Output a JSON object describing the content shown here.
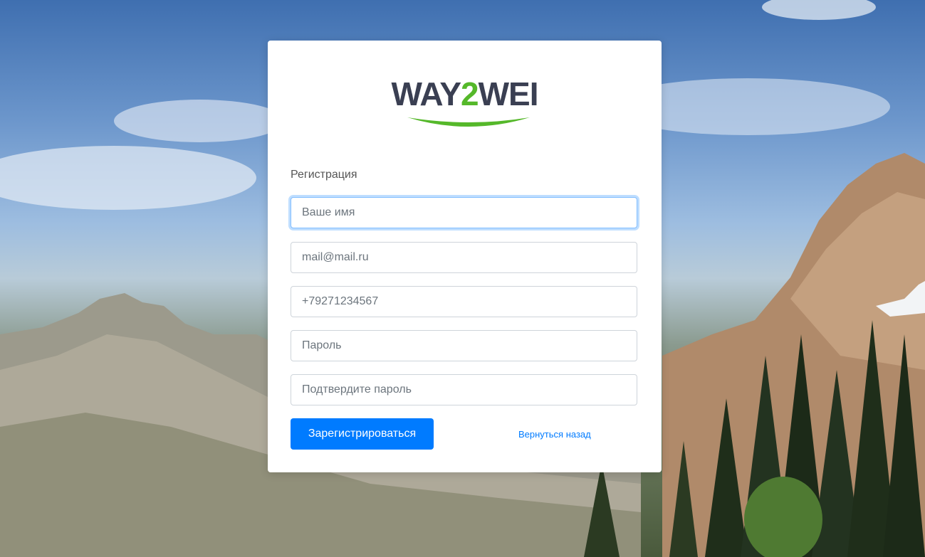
{
  "brand": {
    "logo_prefix": "WAY",
    "logo_digit": "2",
    "logo_suffix": "WEI",
    "accent_color": "#55b82a",
    "text_color": "#3a3f52"
  },
  "form": {
    "title": "Регистрация",
    "fields": {
      "name_placeholder": "Ваше имя",
      "email_placeholder": "mail@mail.ru",
      "phone_placeholder": "+79271234567",
      "password_placeholder": "Пароль",
      "confirm_placeholder": "Подтвердите пароль"
    },
    "submit_label": "Зарегистрироваться",
    "back_link": "Вернуться назад"
  },
  "colors": {
    "primary": "#007bff"
  }
}
